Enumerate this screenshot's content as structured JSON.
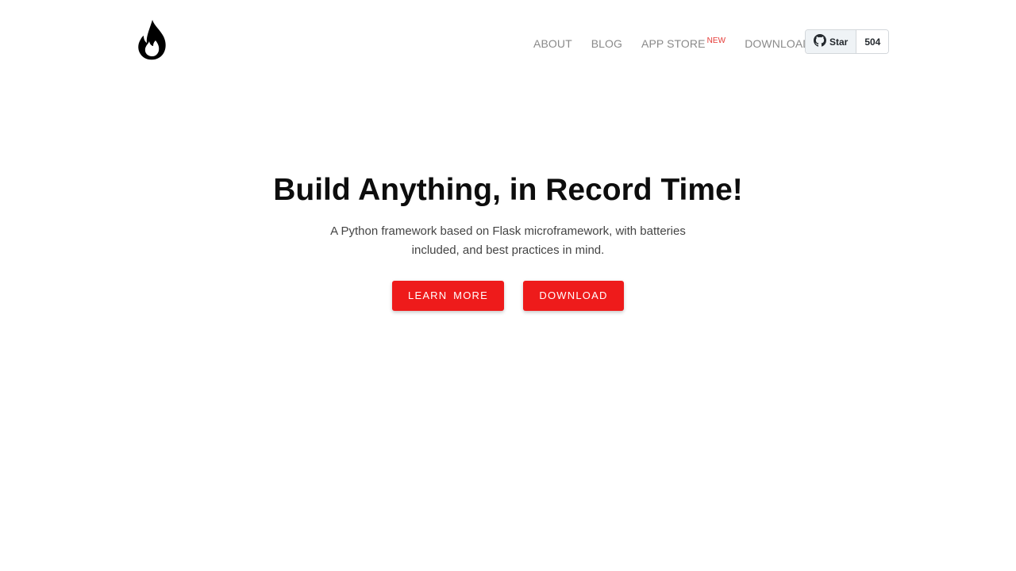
{
  "brand": {
    "logo_icon": "flame-icon",
    "logo_color": "#000000"
  },
  "nav": {
    "items": [
      {
        "label": "ABOUT"
      },
      {
        "label": "BLOG"
      },
      {
        "label": "APP STORE",
        "badge": "NEW"
      },
      {
        "label": "DOWNLOAD"
      }
    ],
    "link_color": "#8a8a8a",
    "badge_color": "#e53935"
  },
  "github": {
    "icon": "github-icon",
    "star_label": "Star",
    "star_count": "504"
  },
  "hero": {
    "title": "Build Anything, in Record Time!",
    "subtitle": "A Python framework based on Flask microframework, with batteries included, and best practices in mind.",
    "buttons": {
      "learn_more": "LEARN MORE",
      "download": "DOWNLOAD"
    },
    "button_color": "#ee1b1b"
  }
}
